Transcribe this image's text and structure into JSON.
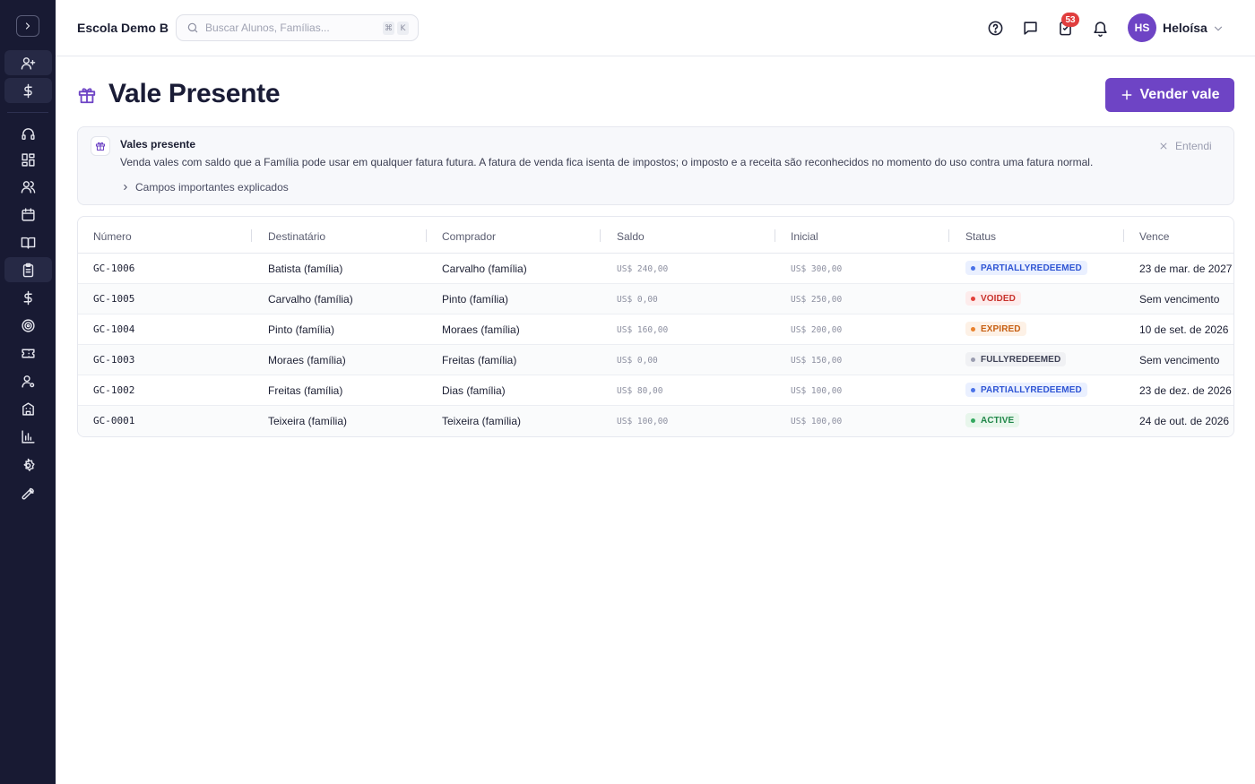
{
  "colors": {
    "sidebar_bg": "#181a33",
    "accent": "#6e44c5",
    "notification_badge": "#e03e3e"
  },
  "sidebar": {
    "toggle_icon": "chevron-right-icon",
    "items": [
      {
        "icon": "user-plus-icon"
      },
      {
        "icon": "dollar-icon"
      },
      {
        "icon": "headset-icon"
      },
      {
        "icon": "dashboard-icon"
      },
      {
        "icon": "users-icon"
      },
      {
        "icon": "calendar-icon"
      },
      {
        "icon": "book-icon"
      },
      {
        "icon": "clipboard-icon"
      },
      {
        "icon": "dollar-icon"
      },
      {
        "icon": "target-icon"
      },
      {
        "icon": "ticket-icon"
      },
      {
        "icon": "user-gear-icon"
      },
      {
        "icon": "building-icon"
      },
      {
        "icon": "bar-chart-icon"
      },
      {
        "icon": "settings-icon"
      },
      {
        "icon": "wrench-icon"
      }
    ]
  },
  "header": {
    "school_name": "Escola Demo B",
    "search": {
      "placeholder": "Buscar Alunos, Famílias...",
      "shortcut_keys": [
        "⌘",
        "K"
      ]
    },
    "icons": [
      "help-icon",
      "chat-icon",
      "tasks-icon",
      "bell-icon"
    ],
    "tasks_badge": "53",
    "user": {
      "initials": "HS",
      "name": "Heloísa"
    }
  },
  "page": {
    "title": "Vale Presente",
    "primary_action": "Vender vale"
  },
  "info_card": {
    "title": "Vales presente",
    "description": "Venda vales com saldo que a Família pode usar em qualquer fatura futura. A fatura de venda fica isenta de impostos; o imposto e a receita são reconhecidos no momento do uso contra uma fatura normal.",
    "expand_label": "Campos importantes explicados",
    "dismiss_label": "Entendi"
  },
  "table": {
    "columns": [
      "Número",
      "Destinatário",
      "Comprador",
      "Saldo",
      "Inicial",
      "Status",
      "Vence"
    ],
    "rows": [
      {
        "number": "GC-1006",
        "recipient": "Batista (família)",
        "buyer": "Carvalho (família)",
        "balance": "US$ 240,00",
        "initial": "US$ 300,00",
        "status": "PARTIALLYREDEEMED",
        "status_tone": "blue",
        "expires": "23 de mar. de 2027"
      },
      {
        "number": "GC-1005",
        "recipient": "Carvalho (família)",
        "buyer": "Pinto (família)",
        "balance": "US$ 0,00",
        "initial": "US$ 250,00",
        "status": "VOIDED",
        "status_tone": "red",
        "expires": "Sem vencimento"
      },
      {
        "number": "GC-1004",
        "recipient": "Pinto (família)",
        "buyer": "Moraes (família)",
        "balance": "US$ 160,00",
        "initial": "US$ 200,00",
        "status": "EXPIRED",
        "status_tone": "orange",
        "expires": "10 de set. de 2026"
      },
      {
        "number": "GC-1003",
        "recipient": "Moraes (família)",
        "buyer": "Freitas (família)",
        "balance": "US$ 0,00",
        "initial": "US$ 150,00",
        "status": "FULLYREDEEMED",
        "status_tone": "gray",
        "expires": "Sem vencimento"
      },
      {
        "number": "GC-1002",
        "recipient": "Freitas (família)",
        "buyer": "Dias (família)",
        "balance": "US$ 80,00",
        "initial": "US$ 100,00",
        "status": "PARTIALLYREDEEMED",
        "status_tone": "blue",
        "expires": "23 de dez. de 2026"
      },
      {
        "number": "GC-0001",
        "recipient": "Teixeira (família)",
        "buyer": "Teixeira (família)",
        "balance": "US$ 100,00",
        "initial": "US$ 100,00",
        "status": "ACTIVE",
        "status_tone": "green",
        "expires": "24 de out. de 2026"
      }
    ],
    "status_tones": {
      "blue": {
        "bg": "#eaf0ff",
        "fg": "#2f55d4",
        "dot": "#4a72e8"
      },
      "red": {
        "bg": "#fdecec",
        "fg": "#c8322c",
        "dot": "#e2403a"
      },
      "orange": {
        "bg": "#fdf1e6",
        "fg": "#c75f12",
        "dot": "#e9822d"
      },
      "gray": {
        "bg": "#f0f1f4",
        "fg": "#3f4256",
        "dot": "#9a9db0"
      },
      "green": {
        "bg": "#e8f6ec",
        "fg": "#21874a",
        "dot": "#34a860"
      }
    }
  }
}
